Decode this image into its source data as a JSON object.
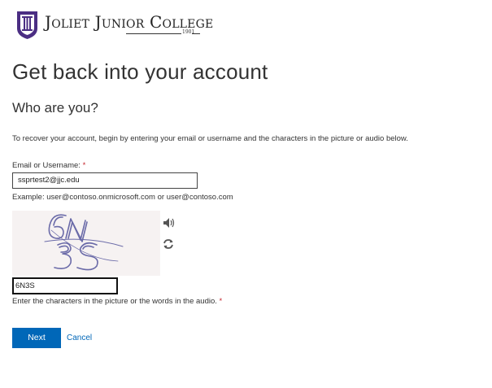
{
  "header": {
    "logo_text": "Joliet Junior College",
    "logo_year": "1901",
    "logo_icon": "college-shield-icon"
  },
  "page": {
    "title": "Get back into your account",
    "subtitle": "Who are you?",
    "instructions": "To recover your account, begin by entering your email or username and the characters in the picture or audio below."
  },
  "form": {
    "email_label": "Email or Username:",
    "required_marker": "*",
    "email_value": "ssprtest2@jjc.edu",
    "email_example": "Example: user@contoso.onmicrosoft.com or user@contoso.com",
    "captcha_image_text": "6N3S",
    "captcha_audio_icon": "speaker-icon",
    "captcha_refresh_icon": "refresh-icon",
    "captcha_value": "6N3S",
    "captcha_hint": "Enter the characters in the picture or the words in the audio."
  },
  "actions": {
    "next_label": "Next",
    "cancel_label": "Cancel"
  },
  "colors": {
    "brand_purple": "#4b2e83",
    "accent_blue": "#0067b8",
    "required_red": "#c4262e"
  }
}
